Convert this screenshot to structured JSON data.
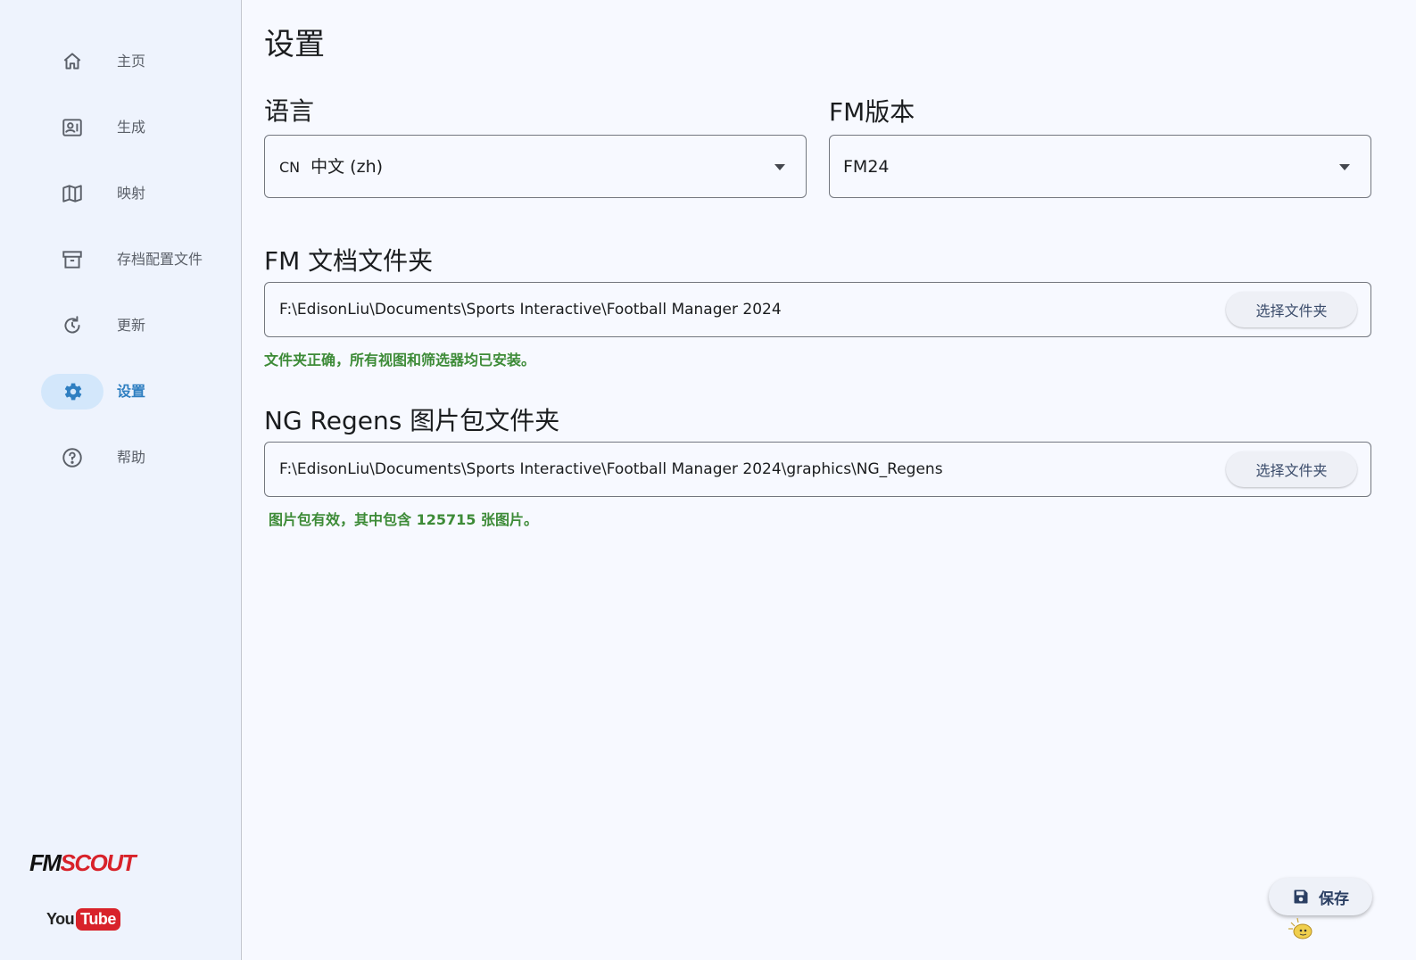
{
  "sidebar": {
    "items": [
      {
        "label": "主页",
        "icon": "home-icon"
      },
      {
        "label": "生成",
        "icon": "contact-card-icon"
      },
      {
        "label": "映射",
        "icon": "map-icon"
      },
      {
        "label": "存档配置文件",
        "icon": "archive-box-icon"
      },
      {
        "label": "更新",
        "icon": "refresh-icon"
      },
      {
        "label": "设置",
        "icon": "gear-icon",
        "active": true
      },
      {
        "label": "帮助",
        "icon": "help-circle-icon"
      }
    ],
    "brand_fm": "FM",
    "brand_scout": "SCOUT",
    "youtube_you": "You",
    "youtube_tube": "Tube"
  },
  "page": {
    "title": "设置"
  },
  "language": {
    "label": "语言",
    "flag": "CN",
    "selected": "中文 (zh)"
  },
  "fm_version": {
    "label": "FM版本",
    "selected": "FM24"
  },
  "fm_folder": {
    "label": "FM 文档文件夹",
    "path": "F:\\EdisonLiu\\Documents\\Sports Interactive\\Football Manager 2024",
    "button": "选择文件夹",
    "status": "文件夹正确，所有视图和筛选器均已安装。"
  },
  "regens_folder": {
    "label": "NG Regens 图片包文件夹",
    "path": "F:\\EdisonLiu\\Documents\\Sports Interactive\\Football Manager 2024\\graphics\\NG_Regens",
    "button": "选择文件夹",
    "status": "图片包有效，其中包含 125715 张图片。"
  },
  "actions": {
    "save": "保存"
  },
  "colors": {
    "accent": "#2f7fc1",
    "active_bg": "#d3e7fb",
    "success": "#3d8b37",
    "brand_red": "#d8222a"
  }
}
